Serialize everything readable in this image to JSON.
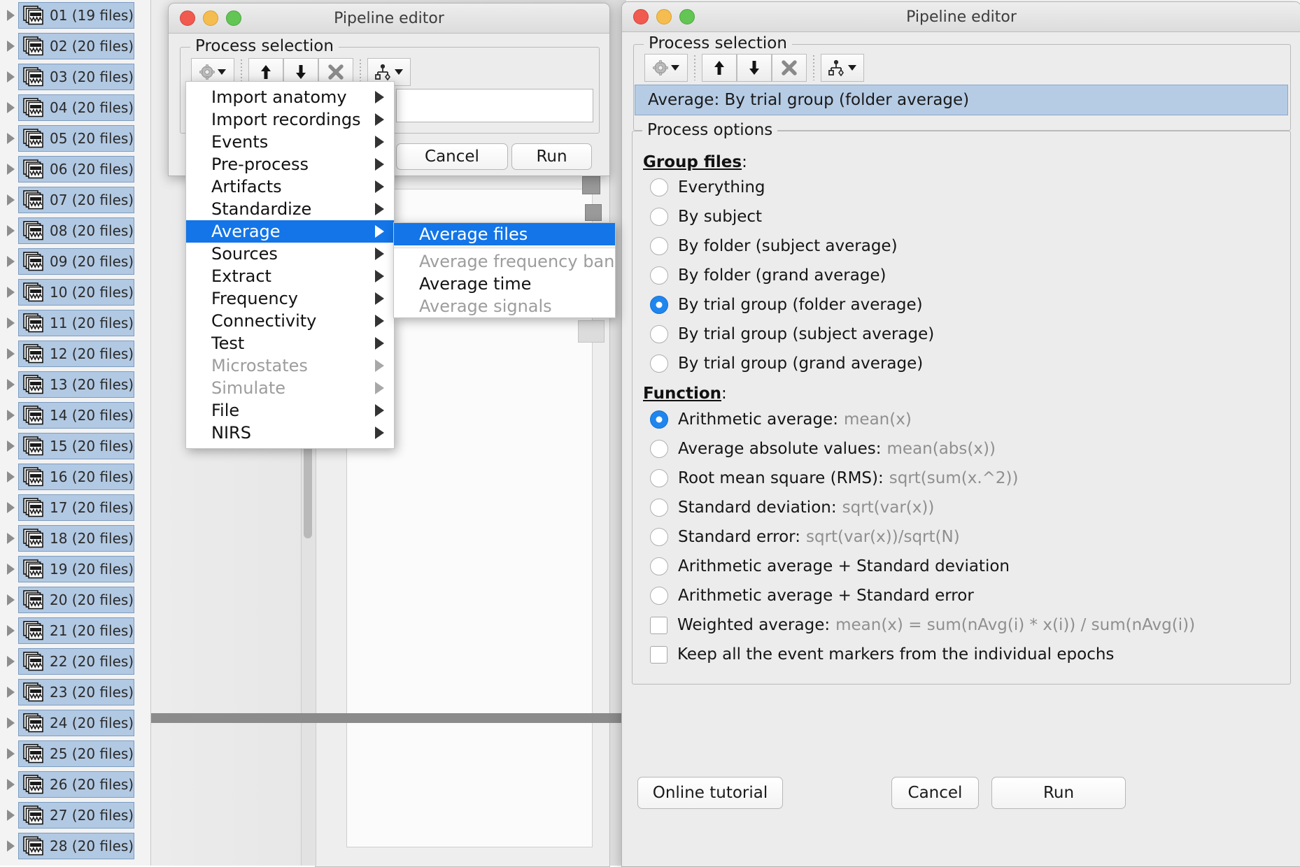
{
  "file_tree": {
    "items": [
      {
        "label": "01 (19 files)"
      },
      {
        "label": "02 (20 files)"
      },
      {
        "label": "03 (20 files)"
      },
      {
        "label": "04 (20 files)"
      },
      {
        "label": "05 (20 files)"
      },
      {
        "label": "06 (20 files)"
      },
      {
        "label": "07 (20 files)"
      },
      {
        "label": "08 (20 files)"
      },
      {
        "label": "09 (20 files)"
      },
      {
        "label": "10 (20 files)"
      },
      {
        "label": "11 (20 files)"
      },
      {
        "label": "12 (20 files)"
      },
      {
        "label": "13 (20 files)"
      },
      {
        "label": "14 (20 files)"
      },
      {
        "label": "15 (20 files)"
      },
      {
        "label": "16 (20 files)"
      },
      {
        "label": "17 (20 files)"
      },
      {
        "label": "18 (20 files)"
      },
      {
        "label": "19 (20 files)"
      },
      {
        "label": "20 (20 files)"
      },
      {
        "label": "21 (20 files)"
      },
      {
        "label": "22 (20 files)"
      },
      {
        "label": "23 (20 files)"
      },
      {
        "label": "24 (20 files)"
      },
      {
        "label": "25 (20 files)"
      },
      {
        "label": "26 (20 files)"
      },
      {
        "label": "27 (20 files)"
      },
      {
        "label": "28 (20 files)"
      }
    ]
  },
  "left_dialog": {
    "title": "Pipeline editor",
    "process_selection_legend": "Process selection",
    "toolbar": {
      "gear_icon": "gear-icon",
      "gear_caret_icon": "caret-down-icon",
      "move_up_icon": "arrow-up-icon",
      "move_down_icon": "arrow-down-icon",
      "delete_icon": "x-cross-icon",
      "pipeline_icon": "pipeline-tree-icon",
      "pipeline_caret_icon": "caret-down-icon"
    },
    "buttons": {
      "cancel": "Cancel",
      "run": "Run"
    }
  },
  "process_menu": {
    "items": [
      {
        "label": "Import anatomy",
        "state": "normal",
        "submenu": true
      },
      {
        "label": "Import recordings",
        "state": "normal",
        "submenu": true
      },
      {
        "label": "Events",
        "state": "normal",
        "submenu": true
      },
      {
        "label": "Pre-process",
        "state": "normal",
        "submenu": true
      },
      {
        "label": "Artifacts",
        "state": "normal",
        "submenu": true
      },
      {
        "label": "Standardize",
        "state": "normal",
        "submenu": true
      },
      {
        "label": "Average",
        "state": "selected",
        "submenu": true
      },
      {
        "label": "Sources",
        "state": "normal",
        "submenu": true
      },
      {
        "label": "Extract",
        "state": "normal",
        "submenu": true
      },
      {
        "label": "Frequency",
        "state": "normal",
        "submenu": true
      },
      {
        "label": "Connectivity",
        "state": "normal",
        "submenu": true
      },
      {
        "label": "Test",
        "state": "normal",
        "submenu": true
      },
      {
        "label": "Microstates",
        "state": "disabled",
        "submenu": true
      },
      {
        "label": "Simulate",
        "state": "disabled",
        "submenu": true
      },
      {
        "label": "File",
        "state": "normal",
        "submenu": true
      },
      {
        "label": "NIRS",
        "state": "normal",
        "submenu": true
      }
    ]
  },
  "average_submenu": {
    "items": [
      {
        "label": "Average files",
        "state": "selected"
      },
      {
        "label": "Average frequency bands",
        "state": "disabled"
      },
      {
        "label": "Average time",
        "state": "normal"
      },
      {
        "label": "Average signals",
        "state": "disabled"
      }
    ]
  },
  "right_dialog": {
    "title": "Pipeline editor",
    "process_selection_legend": "Process selection",
    "selected_process": "Average: By trial group (folder average)",
    "process_options_legend": "Process options",
    "group_files": {
      "heading": "Group files",
      "heading_suffix": ":",
      "options": [
        {
          "label": "Everything",
          "checked": false
        },
        {
          "label": "By subject",
          "checked": false
        },
        {
          "label": "By folder (subject average)",
          "checked": false
        },
        {
          "label": "By folder (grand average)",
          "checked": false
        },
        {
          "label": "By trial group (folder average)",
          "checked": true
        },
        {
          "label": "By trial group (subject average)",
          "checked": false
        },
        {
          "label": "By trial group (grand average)",
          "checked": false
        }
      ]
    },
    "function": {
      "heading": "Function",
      "heading_suffix": ":",
      "options": [
        {
          "label": "Arithmetic average:",
          "formula": "mean(x)",
          "checked": true,
          "type": "radio"
        },
        {
          "label": "Average absolute values:",
          "formula": "mean(abs(x))",
          "checked": false,
          "type": "radio"
        },
        {
          "label": "Root mean square (RMS):",
          "formula": "sqrt(sum(x.^2))",
          "checked": false,
          "type": "radio"
        },
        {
          "label": "Standard deviation:",
          "formula": "sqrt(var(x))",
          "checked": false,
          "type": "radio"
        },
        {
          "label": "Standard error:",
          "formula": "sqrt(var(x))/sqrt(N)",
          "checked": false,
          "type": "radio"
        },
        {
          "label": "Arithmetic average + Standard deviation",
          "formula": "",
          "checked": false,
          "type": "radio"
        },
        {
          "label": "Arithmetic average + Standard error",
          "formula": "",
          "checked": false,
          "type": "radio"
        },
        {
          "label": "Weighted average:",
          "formula": "mean(x) = sum(nAvg(i) * x(i)) / sum(nAvg(i))",
          "checked": false,
          "type": "checkbox"
        },
        {
          "label": "Keep all the event markers from the individual epochs",
          "formula": "",
          "checked": false,
          "type": "checkbox"
        }
      ]
    },
    "buttons": {
      "online_tutorial": "Online tutorial",
      "cancel": "Cancel",
      "run": "Run"
    },
    "toolbar": {
      "gear_icon": "gear-icon",
      "gear_caret_icon": "caret-down-icon",
      "move_up_icon": "arrow-up-icon",
      "move_down_icon": "arrow-down-icon",
      "delete_icon": "x-cross-icon",
      "pipeline_icon": "pipeline-tree-icon",
      "pipeline_caret_icon": "caret-down-icon"
    }
  },
  "colors": {
    "selection_blue": "#1375e8",
    "radio_blue": "#1f86ef",
    "row_blue": "#b2c9e3",
    "window_gray": "#ececec"
  }
}
